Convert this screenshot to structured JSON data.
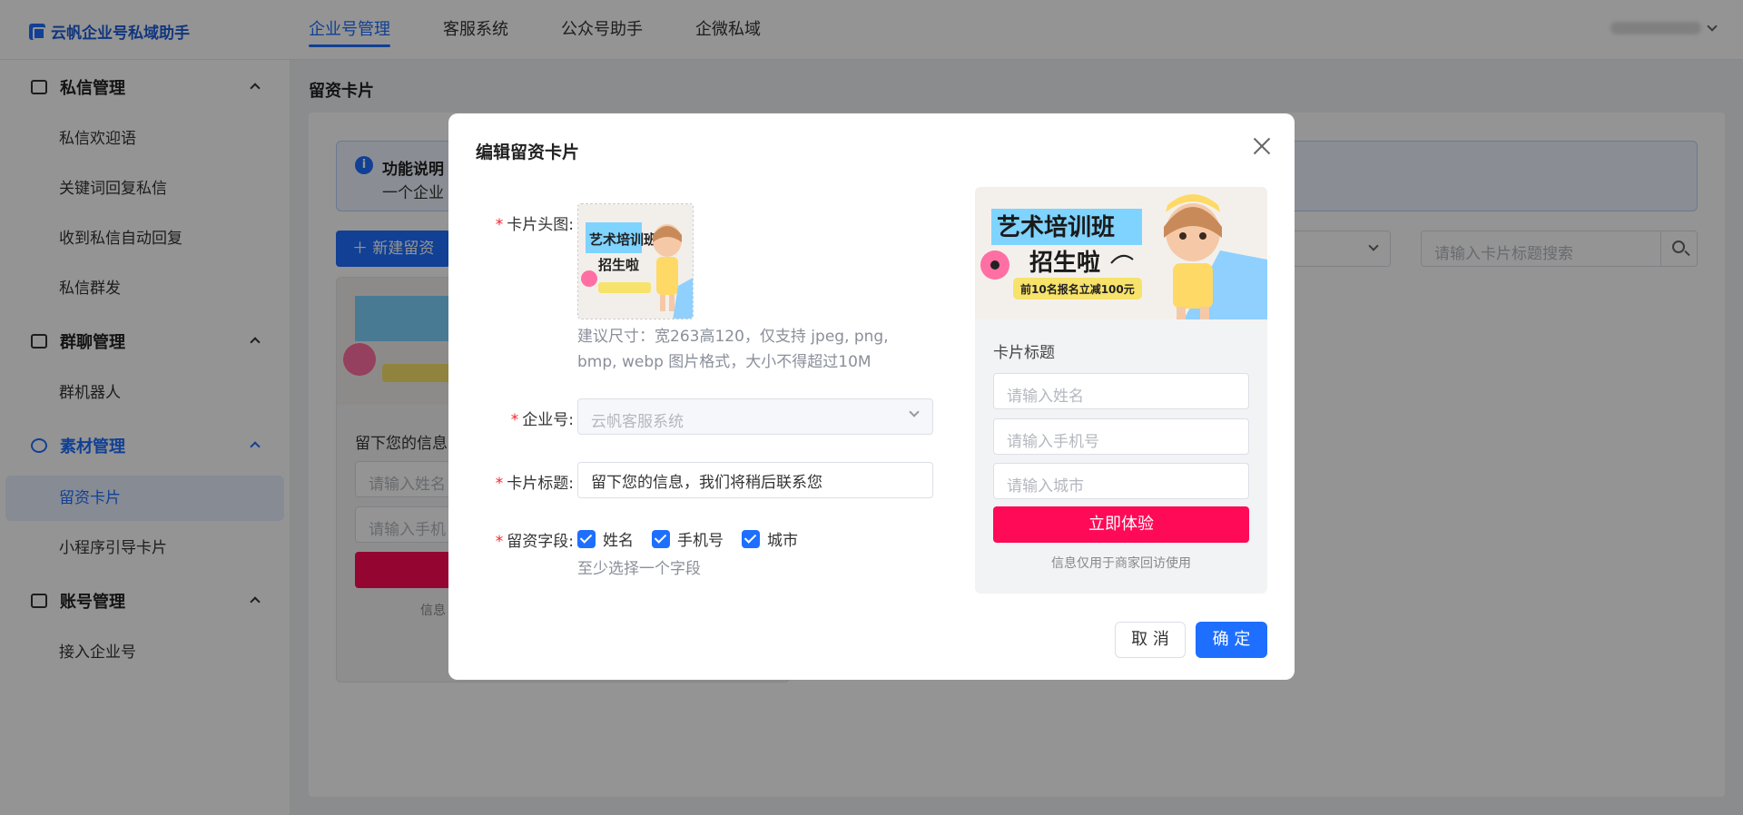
{
  "app": {
    "title": "云帆企业号私域助手"
  },
  "topnav": [
    {
      "label": "企业号管理",
      "active": true
    },
    {
      "label": "客服系统"
    },
    {
      "label": "公众号助手"
    },
    {
      "label": "企微私域"
    }
  ],
  "sidebar": {
    "groups": [
      {
        "label": "私信管理",
        "icon": "message-icon",
        "items": [
          "私信欢迎语",
          "关键词回复私信",
          "收到私信自动回复",
          "私信群发"
        ]
      },
      {
        "label": "群聊管理",
        "icon": "group-chat-icon",
        "items": [
          "群机器人"
        ]
      },
      {
        "label": "素材管理",
        "icon": "material-icon",
        "active": true,
        "items": [
          "留资卡片",
          "小程序引导卡片"
        ],
        "active_item": "留资卡片"
      },
      {
        "label": "账号管理",
        "icon": "shield-icon",
        "items": [
          "接入企业号"
        ]
      }
    ]
  },
  "page": {
    "title": "留资卡片",
    "notice": {
      "title": "功能说明",
      "body": "一个企业"
    },
    "new_button": "新建留资",
    "search_placeholder": "请输入卡片标题搜索",
    "bg_card": {
      "title": "留下您的信息",
      "name_placeholder": "请输入姓名",
      "phone_placeholder": "请输入手机",
      "note": "信息"
    }
  },
  "modal": {
    "title": "编辑留资卡片",
    "image_label": "卡片头图:",
    "image_hint": "建议尺寸：宽263高120，仅支持 jpeg, png, bmp, webp 图片格式，大小不得超过10M",
    "account_label": "企业号:",
    "account_value": "云帆客服系统",
    "card_title_label": "卡片标题:",
    "card_title_value": "留下您的信息，我们将稍后联系您",
    "fields_label": "留资字段:",
    "fields": [
      {
        "label": "姓名",
        "checked": true
      },
      {
        "label": "手机号",
        "checked": true
      },
      {
        "label": "城市",
        "checked": true
      }
    ],
    "fields_hint": "至少选择一个字段",
    "cancel": "取 消",
    "confirm": "确 定"
  },
  "preview": {
    "banner": {
      "line1": "艺术培训班",
      "line2": "招生啦",
      "promo": "前10名报名立减100元"
    },
    "title": "卡片标题",
    "name_placeholder": "请输入姓名",
    "phone_placeholder": "请输入手机号",
    "city_placeholder": "请输入城市",
    "submit": "立即体验",
    "note": "信息仅用于商家回访使用"
  },
  "colors": {
    "primary": "#1e6fff",
    "submit": "#ff0a57"
  }
}
